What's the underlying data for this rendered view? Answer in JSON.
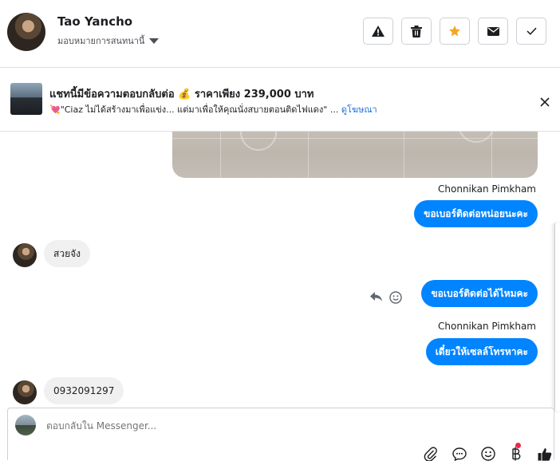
{
  "header": {
    "contact_name": "Tao Yancho",
    "assign_label": "มอบหมายการสนทนานี้",
    "actions": [
      {
        "name": "spam",
        "icon": "warning-icon"
      },
      {
        "name": "delete",
        "icon": "trash-icon"
      },
      {
        "name": "star",
        "icon": "star-icon"
      },
      {
        "name": "mark-unread",
        "icon": "envelope-icon"
      },
      {
        "name": "done",
        "icon": "check-icon"
      }
    ],
    "star_color": "#f5a623"
  },
  "ad": {
    "title": "แชทนี้มีข้อความตอบกลับต่อ 💰 ราคาเพียง 239,000 บาท",
    "subtitle": "💘\"Ciaz ไม่ได้สร้างมาเพื่อแข่ง... แต่มาเพื่อให้คุณนั่งสบายตอนติดไฟแดง\" ...",
    "link": "ดูโฆษณา"
  },
  "messages": {
    "sender_1": "Chonnikan Pimkham",
    "out_1": "ขอเบอร์ติดต่อหน่อยนะคะ",
    "in_1": "สวยจัง",
    "out_2": "ขอเบอร์ติดต่อได้ไหมคะ",
    "sender_2": "Chonnikan Pimkham",
    "out_3": "เดี๋ยวให้เซลล์โทรหาคะ",
    "in_2": "0932091297"
  },
  "composer": {
    "placeholder": "ตอบกลับใน Messenger...",
    "tools": [
      "paperclip-icon",
      "speech-bubble-icon",
      "smiley-icon",
      "baht-icon",
      "thumbs-up-icon"
    ]
  },
  "colors": {
    "outgoing_bubble": "#0084ff",
    "incoming_bubble": "#f0f0f0",
    "link": "#216fdb"
  }
}
